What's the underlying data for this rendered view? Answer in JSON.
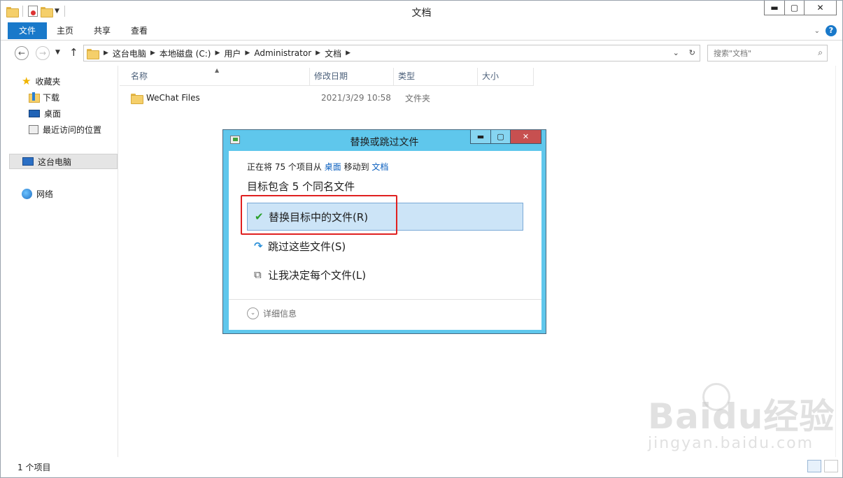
{
  "window": {
    "title": "文档",
    "controls": {
      "minimize": "▬",
      "maximize": "▢",
      "close": "✕"
    }
  },
  "ribbon": {
    "tabs": [
      "文件",
      "主页",
      "共享",
      "查看"
    ],
    "help": "?"
  },
  "address": {
    "crumbs": [
      "这台电脑",
      "本地磁盘 (C:)",
      "用户",
      "Administrator",
      "文档"
    ],
    "search_placeholder": "搜索\"文档\""
  },
  "sidebar": {
    "favorites": "收藏夹",
    "items": [
      "下载",
      "桌面",
      "最近访问的位置"
    ],
    "this_pc": "这台电脑",
    "network": "网络"
  },
  "columns": [
    "名称",
    "修改日期",
    "类型",
    "大小"
  ],
  "files": [
    {
      "name": "WeChat Files",
      "date": "2021/3/29 10:58",
      "type": "文件夹"
    }
  ],
  "status": {
    "count": "1 个项目"
  },
  "dialog": {
    "title": "替换或跳过文件",
    "line_prefix": "正在将 75 个项目从",
    "source": "桌面",
    "line_mid": "移动到",
    "target": "文档",
    "heading": "目标包含 5 个同名文件",
    "options": [
      {
        "label": "替换目标中的文件(R)"
      },
      {
        "label": "跳过这些文件(S)"
      },
      {
        "label": "让我决定每个文件(L)"
      }
    ],
    "details": "详细信息",
    "controls": {
      "minimize": "▬",
      "maximize": "▢",
      "close": "✕"
    }
  },
  "watermark": {
    "main": "Baidu经验",
    "sub": "jingyan.baidu.com"
  },
  "colors": {
    "accent": "#1979ca",
    "dialog_frame": "#5fc7ec",
    "selected_option": "#cce4f7",
    "highlight_box": "#e02020",
    "close_button": "#c75050"
  }
}
